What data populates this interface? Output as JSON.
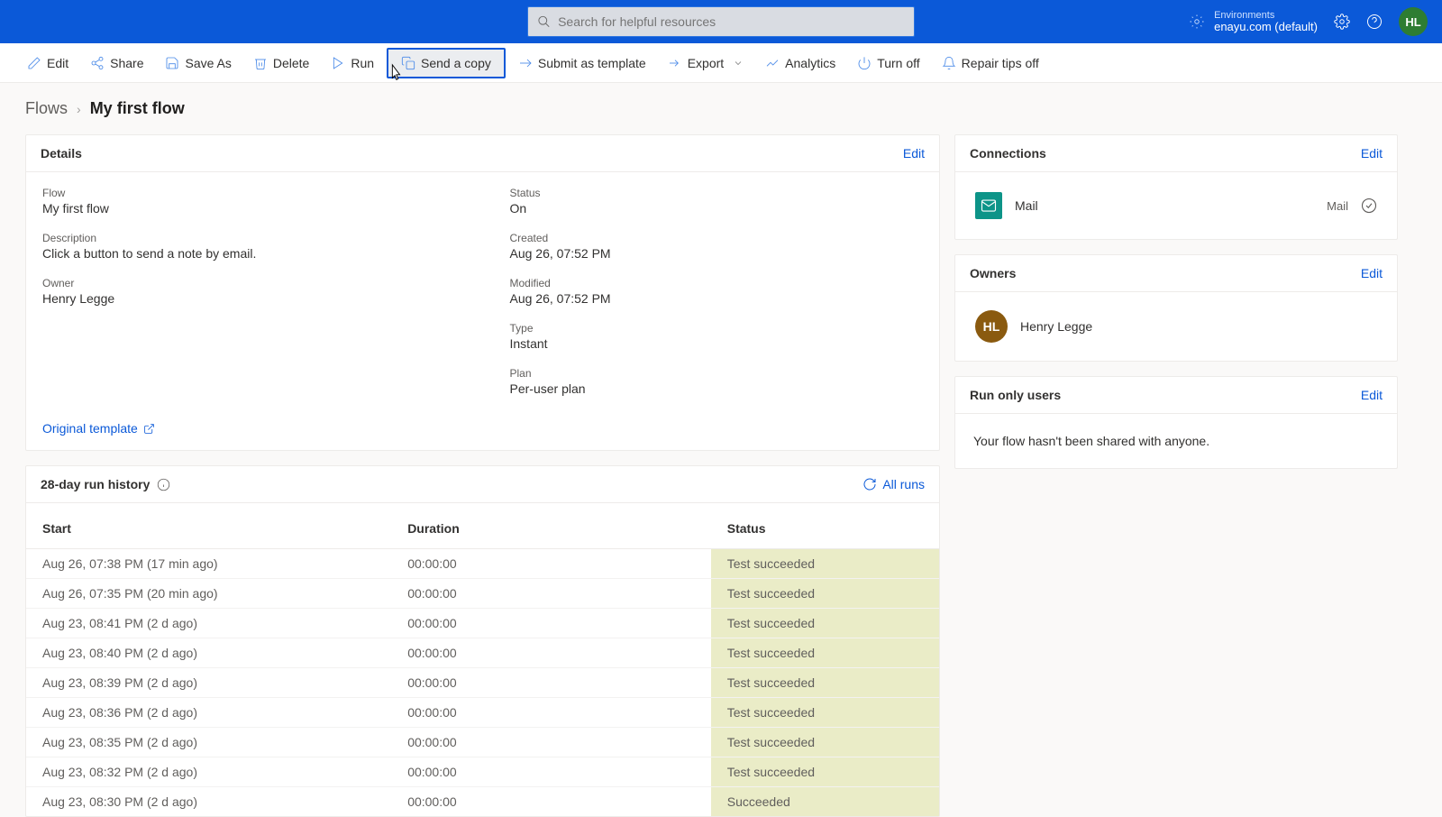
{
  "header": {
    "search_placeholder": "Search for helpful resources",
    "env_label": "Environments",
    "env_name": "enayu.com (default)",
    "avatar": "HL"
  },
  "commands": {
    "edit": "Edit",
    "share": "Share",
    "saveas": "Save As",
    "delete": "Delete",
    "run": "Run",
    "sendcopy": "Send a copy",
    "submit": "Submit as template",
    "export": "Export",
    "analytics": "Analytics",
    "turnoff": "Turn off",
    "repair": "Repair tips off"
  },
  "breadcrumb": {
    "root": "Flows",
    "current": "My first flow"
  },
  "details": {
    "title": "Details",
    "edit": "Edit",
    "flow_label": "Flow",
    "flow_value": "My first flow",
    "desc_label": "Description",
    "desc_value": "Click a button to send a note by email.",
    "owner_label": "Owner",
    "owner_value": "Henry Legge",
    "status_label": "Status",
    "status_value": "On",
    "created_label": "Created",
    "created_value": "Aug 26, 07:52 PM",
    "modified_label": "Modified",
    "modified_value": "Aug 26, 07:52 PM",
    "type_label": "Type",
    "type_value": "Instant",
    "plan_label": "Plan",
    "plan_value": "Per-user plan",
    "orig_template": "Original template"
  },
  "history": {
    "title": "28-day run history",
    "allruns": "All runs",
    "col_start": "Start",
    "col_duration": "Duration",
    "col_status": "Status",
    "rows": [
      {
        "start": "Aug 26, 07:38 PM (17 min ago)",
        "duration": "00:00:00",
        "status": "Test succeeded"
      },
      {
        "start": "Aug 26, 07:35 PM (20 min ago)",
        "duration": "00:00:00",
        "status": "Test succeeded"
      },
      {
        "start": "Aug 23, 08:41 PM (2 d ago)",
        "duration": "00:00:00",
        "status": "Test succeeded"
      },
      {
        "start": "Aug 23, 08:40 PM (2 d ago)",
        "duration": "00:00:00",
        "status": "Test succeeded"
      },
      {
        "start": "Aug 23, 08:39 PM (2 d ago)",
        "duration": "00:00:00",
        "status": "Test succeeded"
      },
      {
        "start": "Aug 23, 08:36 PM (2 d ago)",
        "duration": "00:00:00",
        "status": "Test succeeded"
      },
      {
        "start": "Aug 23, 08:35 PM (2 d ago)",
        "duration": "00:00:00",
        "status": "Test succeeded"
      },
      {
        "start": "Aug 23, 08:32 PM (2 d ago)",
        "duration": "00:00:00",
        "status": "Test succeeded"
      },
      {
        "start": "Aug 23, 08:30 PM (2 d ago)",
        "duration": "00:00:00",
        "status": "Succeeded"
      }
    ]
  },
  "connections": {
    "title": "Connections",
    "edit": "Edit",
    "items": [
      {
        "name": "Mail",
        "type": "Mail"
      }
    ]
  },
  "owners": {
    "title": "Owners",
    "edit": "Edit",
    "items": [
      {
        "initials": "HL",
        "name": "Henry Legge"
      }
    ]
  },
  "runonly": {
    "title": "Run only users",
    "edit": "Edit",
    "text": "Your flow hasn't been shared with anyone."
  }
}
